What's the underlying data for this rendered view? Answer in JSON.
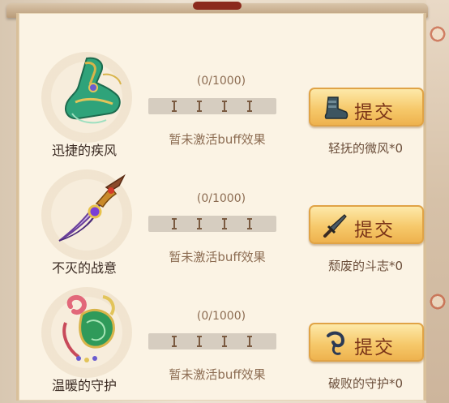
{
  "rows": [
    {
      "name": "迅捷的疾风",
      "progress_text": "(0/1000)",
      "progress": 0,
      "buff_text": "暂未激活buff效果",
      "button_label": "提交",
      "requirement": "轻抚的微风*0",
      "item_icon": "jade-boot-icon",
      "button_icon": "boot-icon"
    },
    {
      "name": "不灭的战意",
      "progress_text": "(0/1000)",
      "progress": 0,
      "buff_text": "暂未激活buff效果",
      "button_label": "提交",
      "requirement": "颓废的斗志*0",
      "item_icon": "purple-dagger-icon",
      "button_icon": "sword-icon"
    },
    {
      "name": "温暖的守护",
      "progress_text": "(0/1000)",
      "progress": 0,
      "buff_text": "暂未激活buff效果",
      "button_label": "提交",
      "requirement": "破败的守护*0",
      "item_icon": "jade-amulet-icon",
      "button_icon": "hook-icon"
    }
  ],
  "colors": {
    "panel": "#fbf3e4",
    "button": "#f6c96b",
    "button_text": "#7b3418",
    "muted_text": "#8c6c52"
  }
}
